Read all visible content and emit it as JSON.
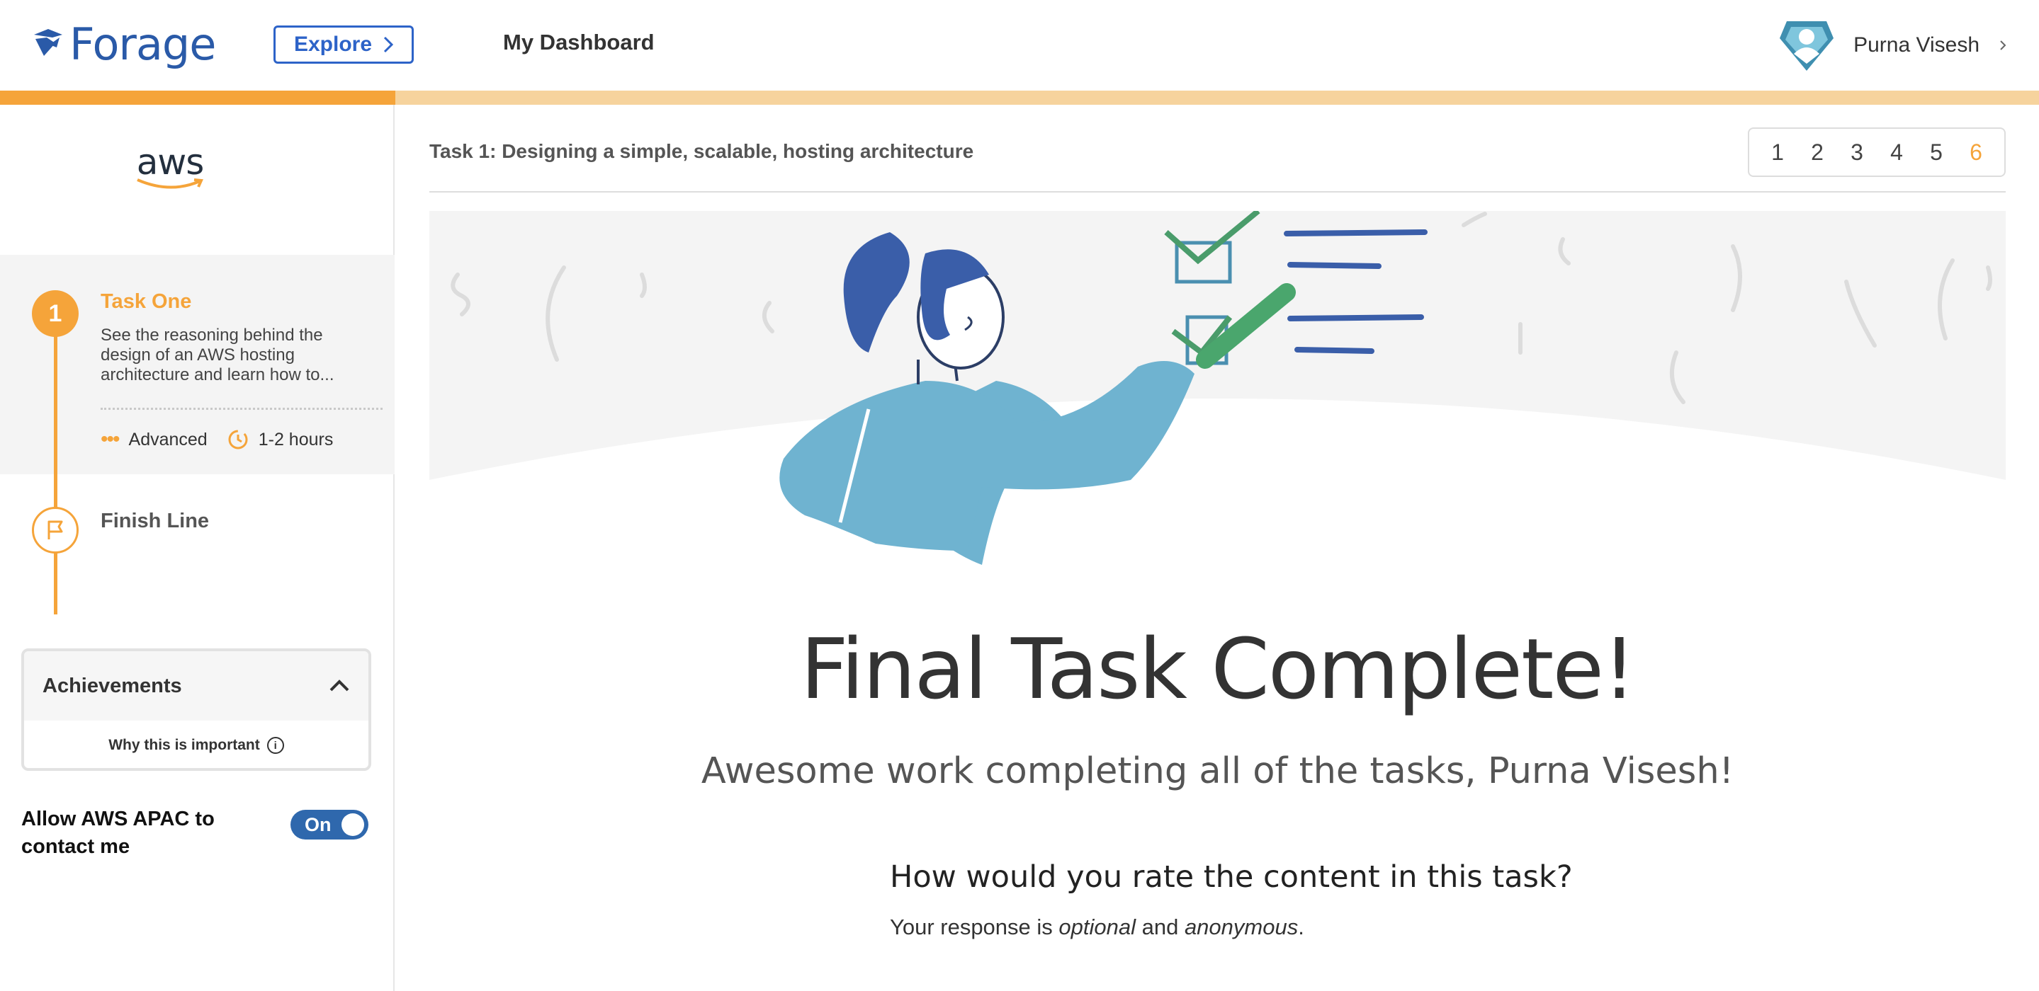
{
  "header": {
    "logo_text": "Forage",
    "explore_label": "Explore",
    "dashboard_label": "My Dashboard",
    "user_name": "Purna Visesh"
  },
  "progress": {
    "completed_fraction": 0.194
  },
  "sidebar": {
    "company_logo_text": "aws",
    "task": {
      "number": "1",
      "title": "Task One",
      "description": "See the reasoning behind the design of an AWS hosting architecture and learn how to...",
      "level": "Advanced",
      "duration": "1-2 hours"
    },
    "finish_label": "Finish Line",
    "achievements": {
      "title": "Achievements",
      "why_label": "Why this is important"
    },
    "contact": {
      "label": "Allow AWS APAC to contact me",
      "toggle_label": "On"
    }
  },
  "main": {
    "task_heading": "Task 1: Designing a simple, scalable, hosting architecture",
    "pages": [
      "1",
      "2",
      "3",
      "4",
      "5",
      "6"
    ],
    "active_page": "6",
    "title": "Final Task Complete!",
    "subtitle": "Awesome work completing all of the tasks, Purna Visesh!",
    "rating_question": "How would you rate the content in this task?",
    "rating_note_prefix": "Your response is ",
    "rating_note_optional": "optional",
    "rating_note_and": " and ",
    "rating_note_anonymous": "anonymous",
    "rating_note_suffix": "."
  },
  "colors": {
    "accent_orange": "#f5a43a",
    "brand_blue": "#2d63c8",
    "toggle_blue": "#2f68ad"
  }
}
